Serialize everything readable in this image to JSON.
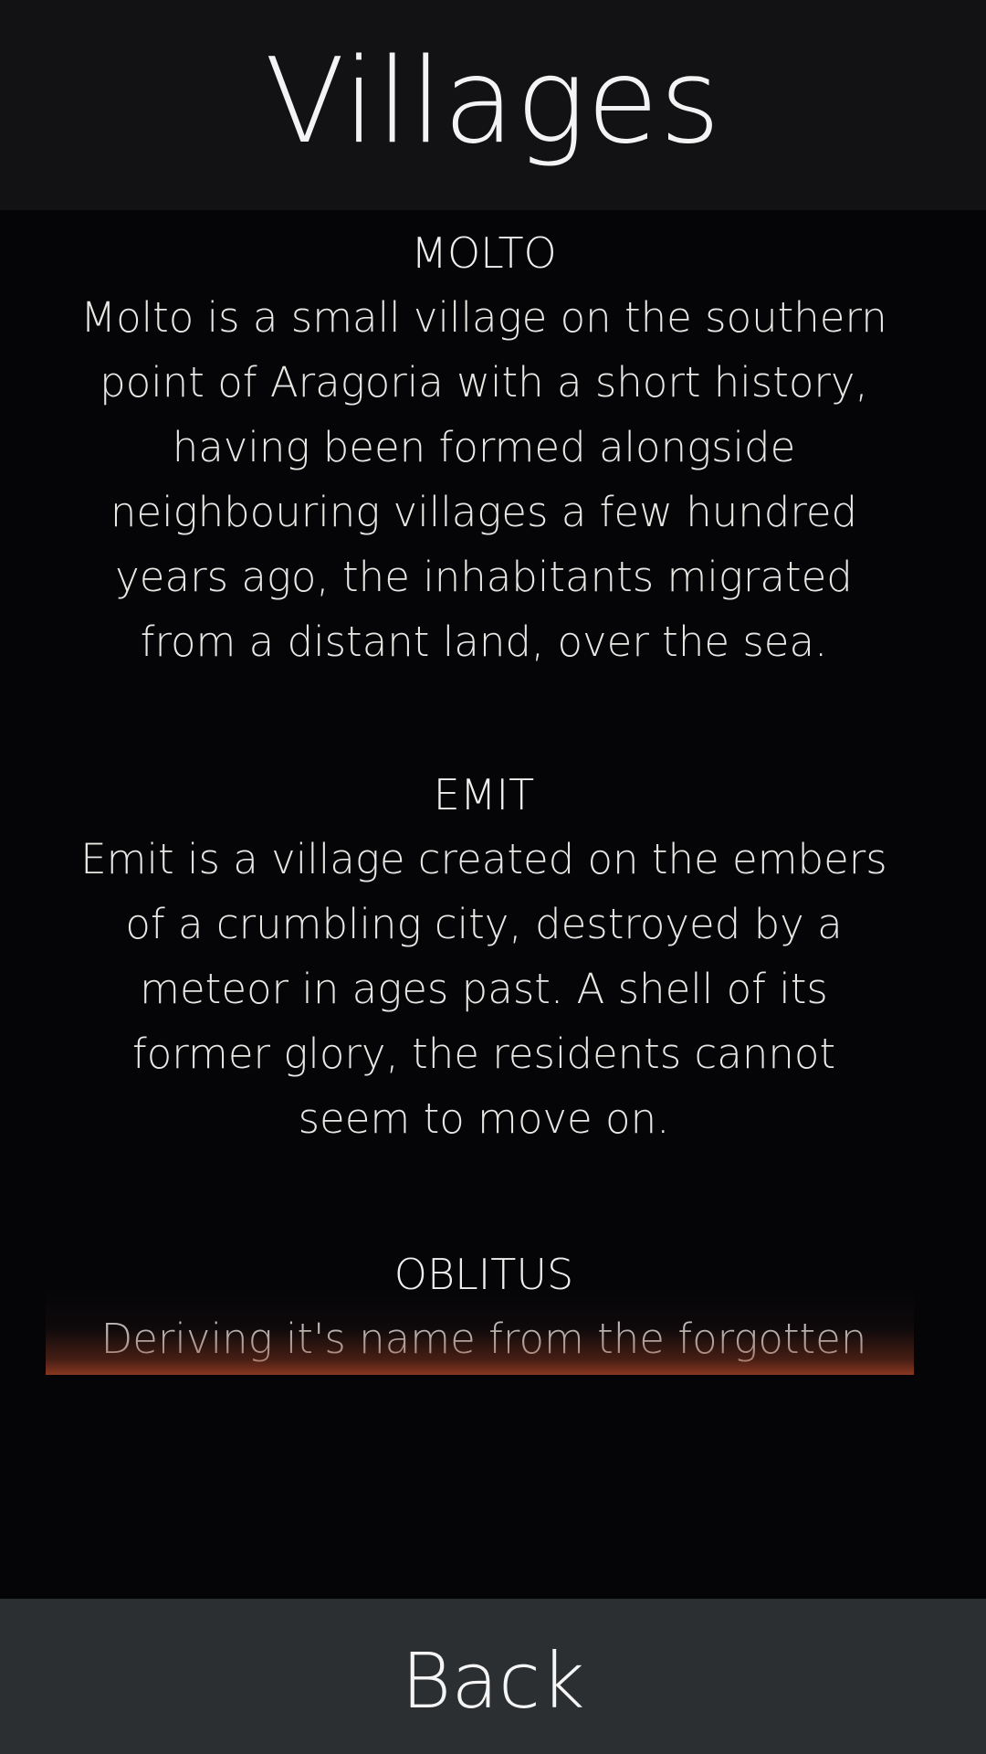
{
  "header": {
    "title": "Villages"
  },
  "villages": [
    {
      "name": "MOLTO",
      "description": "Molto is a small village on the southern point of Aragoria with a short history, having been formed alongside neighbouring villages a few hundred years ago, the inhabitants migrated from a distant land, over the sea."
    },
    {
      "name": "EMIT",
      "description": "Emit is a village created on the embers of a crumbling city, destroyed by a meteor in ages past. A shell of its former glory, the residents cannot seem to move on."
    },
    {
      "name": "OBLITUS",
      "description": "Deriving it's name from the forgotten"
    }
  ],
  "footer": {
    "back_label": "Back"
  },
  "colors": {
    "header_bg": "#121215",
    "content_bg": "#050508",
    "footer_bg": "#2c2f31",
    "accent_glow": "#b4462a"
  }
}
